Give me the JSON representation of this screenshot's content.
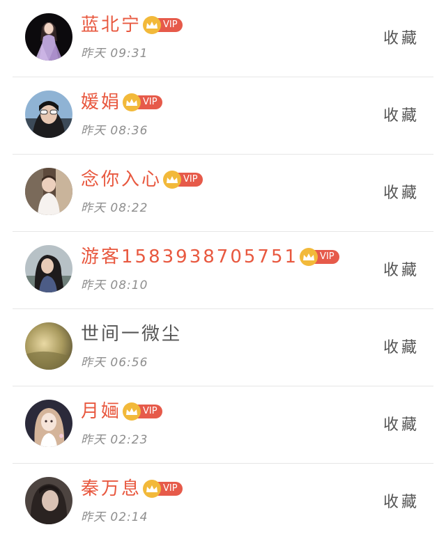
{
  "vip_label": "VIP",
  "colors": {
    "name_vip": "#e8583f",
    "name_plain": "#555555",
    "time": "#8e8e8e",
    "badge": "#e65a4a",
    "crown": "#f2b93a"
  },
  "rows": [
    {
      "name": "蓝北宁",
      "vip": true,
      "time": "昨天 09:31",
      "action": "收藏",
      "avatar": "woman-in-lavender-dress-dark"
    },
    {
      "name": "媛娟",
      "vip": true,
      "time": "昨天 08:36",
      "action": "收藏",
      "avatar": "woman-with-sunglasses"
    },
    {
      "name": "念你入心",
      "vip": true,
      "time": "昨天 08:22",
      "action": "收藏",
      "avatar": "child-in-white-dress"
    },
    {
      "name": "游客15839387057​51",
      "vip": true,
      "time": "昨天 08:10",
      "action": "收藏",
      "avatar": "girl-with-long-hair"
    },
    {
      "name": "世间一微尘",
      "vip": false,
      "time": "昨天 06:56",
      "action": "收藏",
      "avatar": "blurred-golden-landscape"
    },
    {
      "name": "月婳",
      "vip": true,
      "time": "昨天 02:23",
      "action": "收藏",
      "avatar": "illustrated-girl"
    },
    {
      "name": "秦万息",
      "vip": true,
      "time": "昨天 02:14",
      "action": "收藏",
      "avatar": "woman-portrait-dark"
    }
  ]
}
